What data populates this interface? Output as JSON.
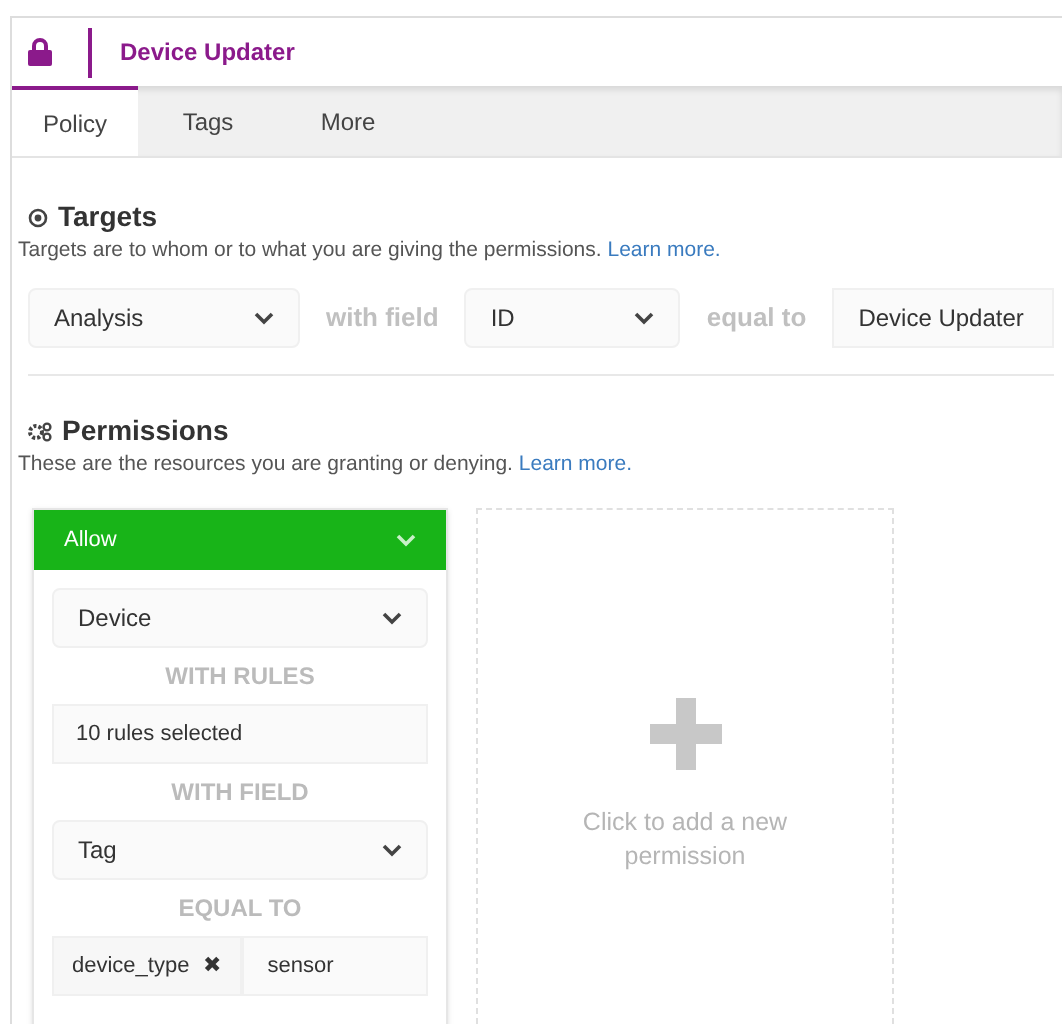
{
  "header": {
    "title": "Device Updater"
  },
  "tabs": [
    {
      "label": "Policy",
      "selected": true
    },
    {
      "label": "Tags",
      "selected": false
    },
    {
      "label": "More",
      "selected": false
    }
  ],
  "targets": {
    "heading": "Targets",
    "description": "Targets are to whom or to what you are giving the permissions.",
    "link": "Learn more.",
    "type_select": "Analysis",
    "with_field_label": "with field",
    "field_select": "ID",
    "equal_to_label": "equal to",
    "value": "Device Updater"
  },
  "permissions": {
    "heading": "Permissions",
    "description": "These are the resources you are granting or denying.",
    "link": "Learn more.",
    "cards": [
      {
        "effect": "Allow",
        "resource": "Device",
        "rules_label": "WITH RULES",
        "rules": "10 rules selected",
        "field_label": "WITH FIELD",
        "field": "Tag",
        "equal_label": "EQUAL TO",
        "tag_key": "device_type",
        "tag_remove": "✖",
        "tag_value": "sensor"
      }
    ],
    "add_card": {
      "text": "Click to add a new permission"
    }
  }
}
